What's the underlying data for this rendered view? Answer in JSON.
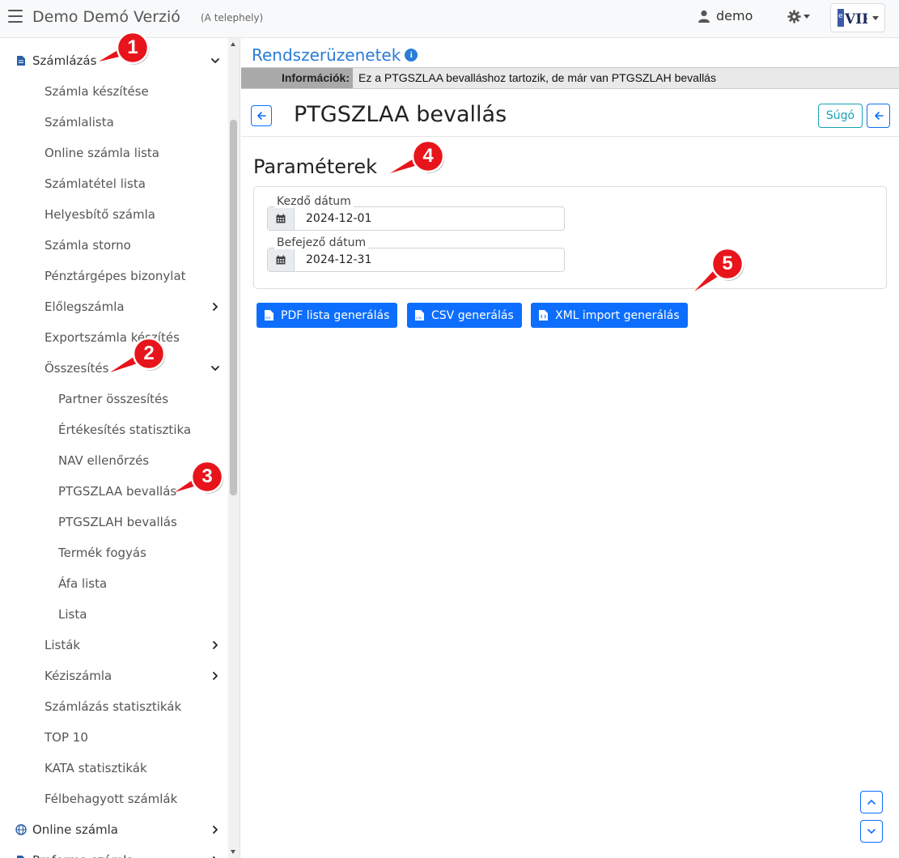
{
  "header": {
    "app_title": "Demo Demó Verzió",
    "location": "(A telephely)",
    "user_name": "demo",
    "logo_text": "VIR"
  },
  "sidebar": {
    "items": [
      {
        "label": "Számlázás",
        "level": 0,
        "icon": "document-icon",
        "chevron": "down"
      },
      {
        "label": "Számla készítése",
        "level": 1
      },
      {
        "label": "Számlalista",
        "level": 1
      },
      {
        "label": "Online számla lista",
        "level": 1
      },
      {
        "label": "Számlatétel lista",
        "level": 1
      },
      {
        "label": "Helyesbítő számla",
        "level": 1
      },
      {
        "label": "Számla storno",
        "level": 1
      },
      {
        "label": "Pénztárgépes bizonylat",
        "level": 1
      },
      {
        "label": "Előlegszámla",
        "level": 1,
        "chevron": "right"
      },
      {
        "label": "Exportszámla készítés",
        "level": 1
      },
      {
        "label": "Összesítés",
        "level": 1,
        "chevron": "down"
      },
      {
        "label": "Partner összesítés",
        "level": 2
      },
      {
        "label": "Értékesítés statisztika",
        "level": 2
      },
      {
        "label": "NAV ellenőrzés",
        "level": 2
      },
      {
        "label": "PTGSZLAA bevallás",
        "level": 2
      },
      {
        "label": "PTGSZLAH bevallás",
        "level": 2
      },
      {
        "label": "Termék fogyás",
        "level": 2
      },
      {
        "label": "Áfa lista",
        "level": 2
      },
      {
        "label": "Lista",
        "level": 2
      },
      {
        "label": "Listák",
        "level": 1,
        "chevron": "right"
      },
      {
        "label": "Kéziszámla",
        "level": 1,
        "chevron": "right"
      },
      {
        "label": "Számlázás statisztikák",
        "level": 1
      },
      {
        "label": "TOP 10",
        "level": 1
      },
      {
        "label": "KATA statisztikák",
        "level": 1
      },
      {
        "label": "Félbehagyott számlák",
        "level": 1
      },
      {
        "label": "Online számla",
        "level": 0,
        "icon": "globe-icon",
        "chevron": "right"
      },
      {
        "label": "Proforma számla",
        "level": 0,
        "icon": "document-icon",
        "chevron": "right"
      }
    ]
  },
  "system_messages": {
    "title": "Rendszerüzenetek",
    "info_label": "Információk:",
    "info_text": "Ez a PTGSZLAA bevalláshoz tartozik, de már van PTGSZLAH bevallás"
  },
  "page": {
    "title": "PTGSZLAA bevallás",
    "help_label": "Súgó"
  },
  "params": {
    "title": "Paraméterek",
    "start_label": "Kezdő dátum",
    "start_value": "2024-12-01",
    "end_label": "Befejező dátum",
    "end_value": "2024-12-31"
  },
  "actions": {
    "pdf_label": "PDF lista generálás",
    "csv_label": "CSV generálás",
    "xml_label": "XML import generálás"
  },
  "callouts": {
    "badges": [
      "1",
      "2",
      "3",
      "4",
      "5"
    ],
    "color": "#e8141b"
  },
  "colors": {
    "primary": "#0d6efd",
    "link": "#2a7bd6",
    "help": "#17a2b8"
  }
}
